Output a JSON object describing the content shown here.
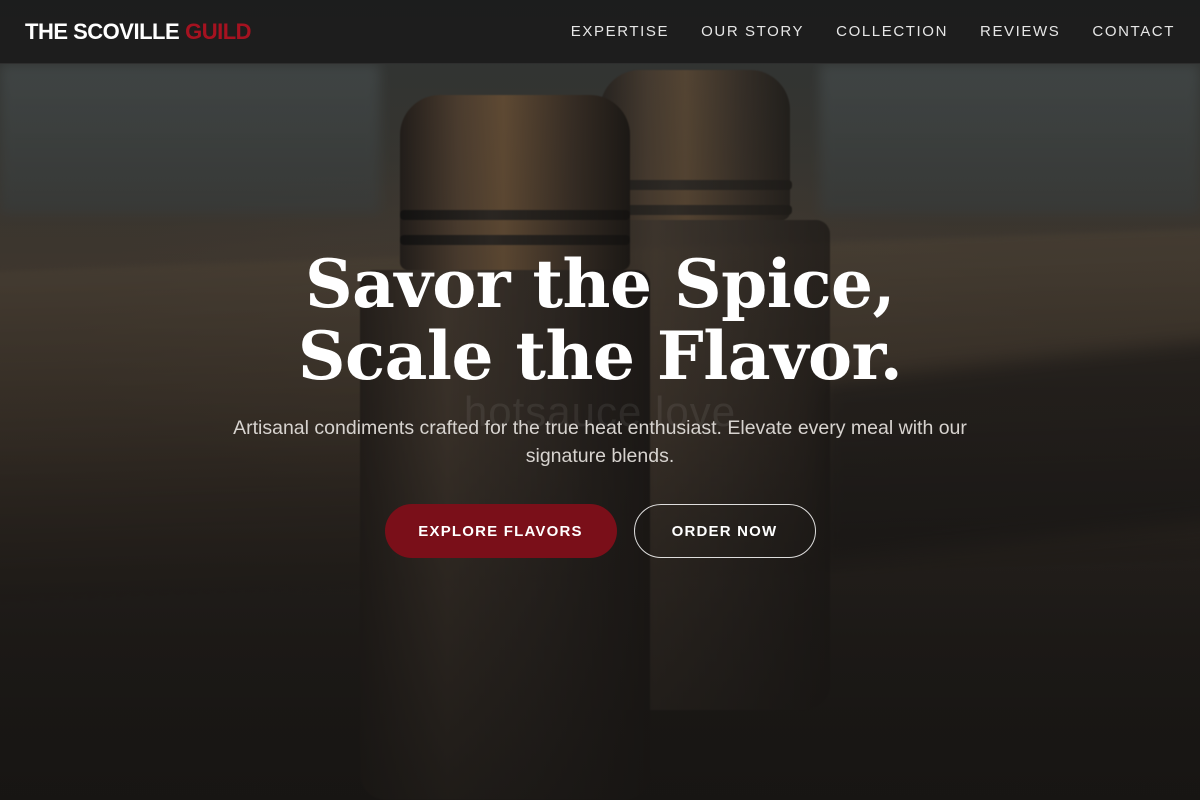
{
  "brand": {
    "name_primary": "THE SCOVILLE",
    "name_accent": "GUILD",
    "accent_color": "#a51220"
  },
  "nav": {
    "links": [
      {
        "label": "EXPERTISE"
      },
      {
        "label": "OUR STORY"
      },
      {
        "label": "COLLECTION"
      },
      {
        "label": "REVIEWS"
      },
      {
        "label": "CONTACT"
      }
    ]
  },
  "hero": {
    "headline_line1": "Savor the Spice,",
    "headline_line2": "Scale the Flavor.",
    "subtitle": "Artisanal condiments crafted for the true heat enthusiast. Elevate every meal with our signature blends.",
    "background_watermark": "hotsauce love",
    "primary_button": "EXPLORE FLAVORS",
    "secondary_button": "ORDER NOW",
    "primary_button_color": "#7a0f19"
  }
}
